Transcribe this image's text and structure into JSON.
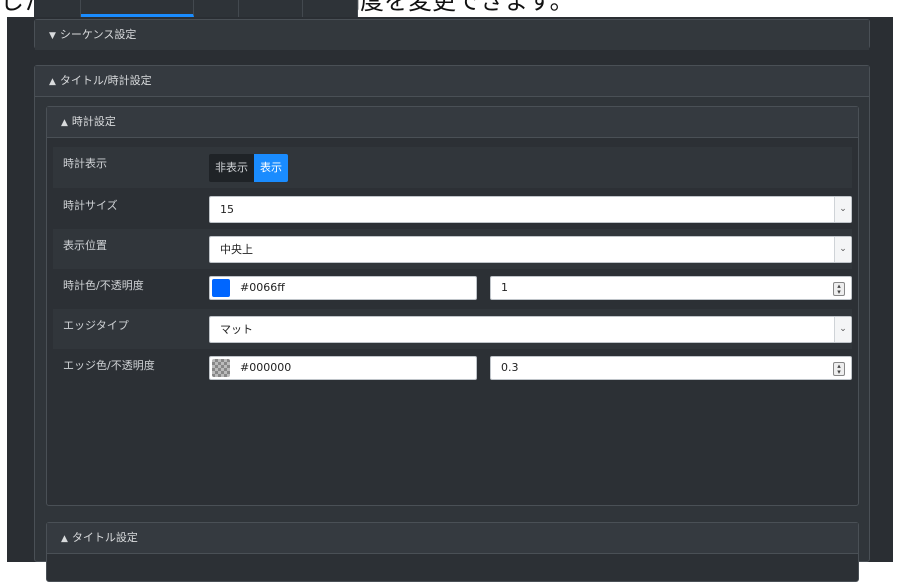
{
  "caption": "した、表示位置、表示色、不透明度を変更できます。",
  "sequence_panel": {
    "title": "シーケンス設定",
    "arrow": "▼"
  },
  "title_clock_panel": {
    "title": "タイトル/時計設定",
    "arrow": "▲"
  },
  "clock_panel": {
    "title": "時計設定",
    "arrow": "▲",
    "display": {
      "label": "時計表示",
      "options": [
        "非表示",
        "表示"
      ],
      "selected": "表示"
    },
    "size": {
      "label": "時計サイズ",
      "value": "15"
    },
    "position": {
      "label": "表示位置",
      "value": "中央上"
    },
    "color": {
      "label": "時計色/不透明度",
      "hex": "#0066ff",
      "opacity": "1",
      "swatch": "#0066ff"
    },
    "edge_type": {
      "label": "エッジタイプ",
      "value": "マット"
    },
    "edge_color": {
      "label": "エッジ色/不透明度",
      "hex": "#000000",
      "opacity": "0.3"
    }
  },
  "title_panel": {
    "title": "タイトル設定",
    "arrow": "▲"
  },
  "icons": {
    "select": "chevron-down-icon",
    "spinner": "spinner-icon"
  },
  "colors": {
    "accent": "#1a8cff",
    "background": "#2a2e33"
  }
}
